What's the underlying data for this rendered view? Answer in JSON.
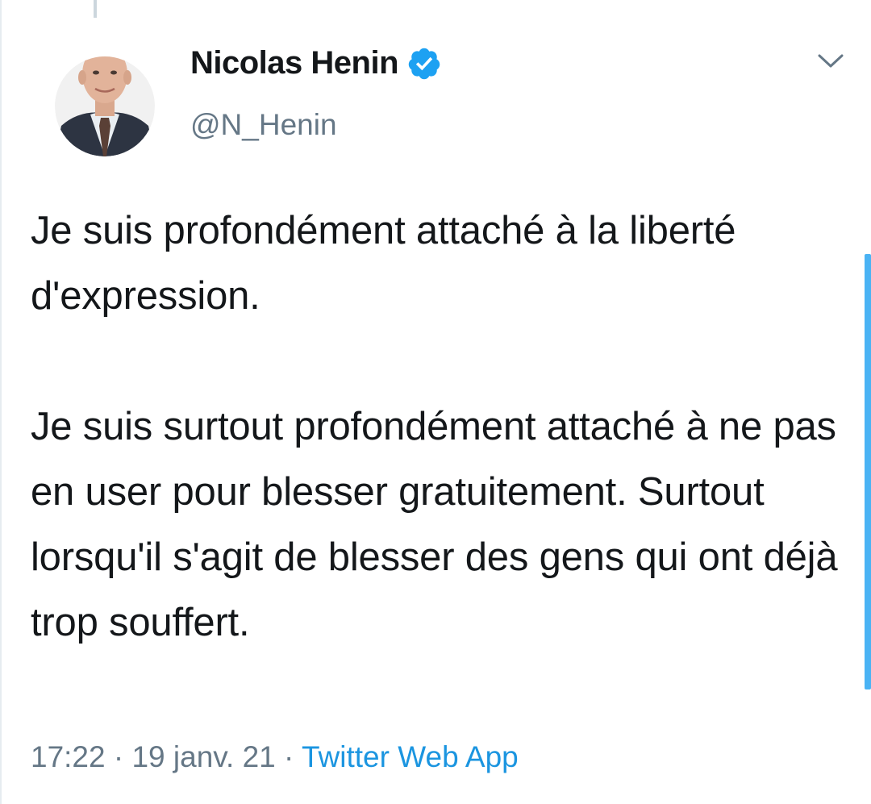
{
  "tweet": {
    "author": {
      "display_name": "Nicolas Henin",
      "handle": "@N_Henin",
      "verified": true
    },
    "text_paragraphs": [
      "Je suis profondément attaché à la liberté d'expression.",
      "Je suis surtout profondément attaché à ne pas en user pour blesser gratuitement. Surtout lorsqu'il s'agit de blesser des gens qui ont déjà trop souffert."
    ],
    "time": "17:22",
    "separator": "·",
    "date": "19 janv. 21",
    "source": "Twitter Web App"
  },
  "icons": {
    "verified": "verified-badge-icon",
    "menu": "chevron-down-icon"
  },
  "colors": {
    "accent": "#1b95e0",
    "text": "#14171a",
    "secondary_text": "#657786",
    "verified_badge": "#1da1f2"
  }
}
